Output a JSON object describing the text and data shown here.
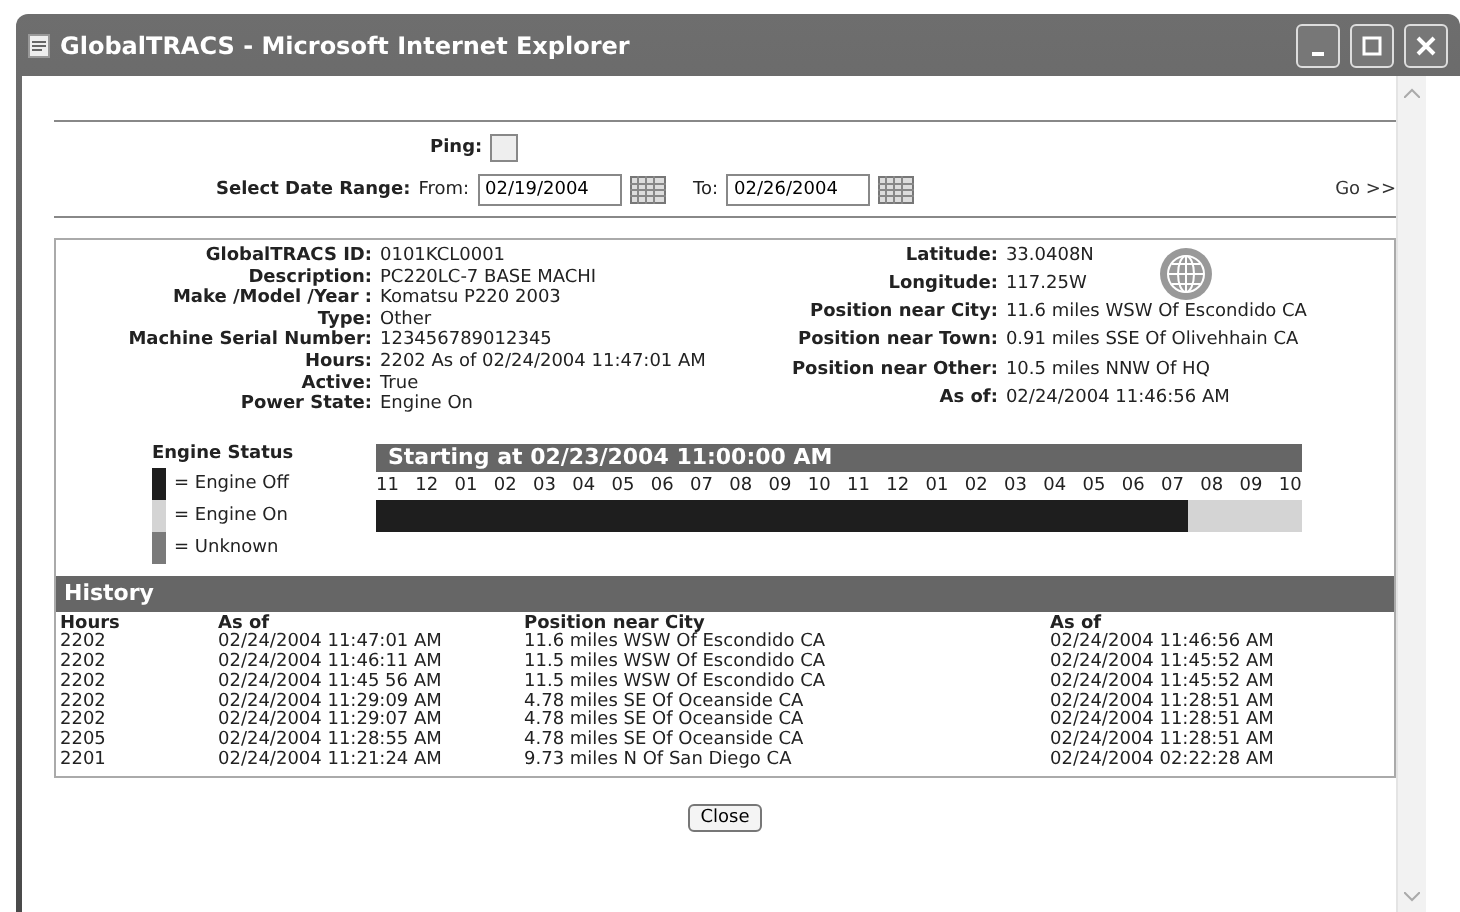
{
  "window": {
    "title": "GlobalTRACS - Microsoft Internet Explorer"
  },
  "ping": {
    "label": "Ping:",
    "checked": false
  },
  "date_range": {
    "label": "Select Date Range:",
    "from_label": "From:",
    "from": "02/19/2004",
    "to_label": "To:",
    "to": "02/26/2004",
    "go": "Go >>"
  },
  "details_left": [
    {
      "label": "GlobalTRACS ID:",
      "value": "0101KCL0001"
    },
    {
      "label": "Description:",
      "value": "PC220LC-7 BASE MACHI"
    },
    {
      "label": "Make /Model /Year :",
      "value": "Komatsu  P220  2003"
    },
    {
      "label": "Type:",
      "value": "Other"
    },
    {
      "label": "Machine Serial Number:",
      "value": "123456789012345"
    },
    {
      "label": "Hours:",
      "value": "2202 As of 02/24/2004 11:47:01 AM"
    },
    {
      "label": "Active:",
      "value": "True"
    },
    {
      "label": "Power State:",
      "value": "Engine On"
    }
  ],
  "details_right": [
    {
      "label": "Latitude:",
      "value": "33.0408N"
    },
    {
      "label": "Longitude:",
      "value": "117.25W"
    },
    {
      "label": "Position near City:",
      "value": "11.6 miles WSW Of Escondido CA"
    },
    {
      "label": "Position near Town:",
      "value": "0.91 miles SSE Of Olivehhain CA"
    },
    {
      "label": "Position near Other:",
      "value": "10.5 miles NNW Of HQ"
    },
    {
      "label": "As of:",
      "value": "02/24/2004 11:46:56 AM"
    }
  ],
  "engine_status": {
    "title": "Engine Status",
    "legend": [
      {
        "label": "= Engine Off",
        "color": "#1e1e1e"
      },
      {
        "label": "= Engine On",
        "color": "#d4d4d4"
      },
      {
        "label": "= Unknown",
        "color": "#7a7a7a"
      }
    ]
  },
  "timeline": {
    "title": "Starting at 02/23/2004 11:00:00 AM",
    "hours": [
      "11",
      "12",
      "01",
      "02",
      "03",
      "04",
      "05",
      "06",
      "07",
      "08",
      "09",
      "10",
      "11",
      "12",
      "01",
      "02",
      "03",
      "04",
      "05",
      "06",
      "07",
      "08",
      "09",
      "10"
    ],
    "level": 0.877
  },
  "history": {
    "title": "History",
    "columns": [
      "Hours",
      "As of",
      "Position near City",
      "As of"
    ],
    "rows": [
      [
        "2202",
        "02/24/2004 11:47:01 AM",
        "11.6 miles WSW Of Escondido CA",
        "02/24/2004 11:46:56 AM"
      ],
      [
        "2202",
        "02/24/2004 11:46:11 AM",
        "11.5 miles WSW Of Escondido CA",
        "02/24/2004 11:45:52 AM"
      ],
      [
        "2202",
        "02/24/2004 11:45 56 AM",
        "11.5 miles WSW Of Escondido CA",
        "02/24/2004 11:45:52 AM"
      ],
      [
        "2202",
        "02/24/2004 11:29:09 AM",
        "4.78 miles SE Of Oceanside CA",
        "02/24/2004 11:28:51 AM"
      ],
      [
        "2202",
        "02/24/2004 11:29:07 AM",
        "4.78 miles SE Of Oceanside CA",
        "02/24/2004 11:28:51 AM"
      ],
      [
        "2205",
        "02/24/2004 11:28:55 AM",
        "4.78 miles SE Of Oceanside CA",
        "02/24/2004 11:28:51 AM"
      ],
      [
        "2201",
        "02/24/2004 11:21:24 AM",
        "9.73 miles N Of San Diego CA",
        "02/24/2004 02:22:28 AM"
      ]
    ]
  },
  "close_button": "Close"
}
